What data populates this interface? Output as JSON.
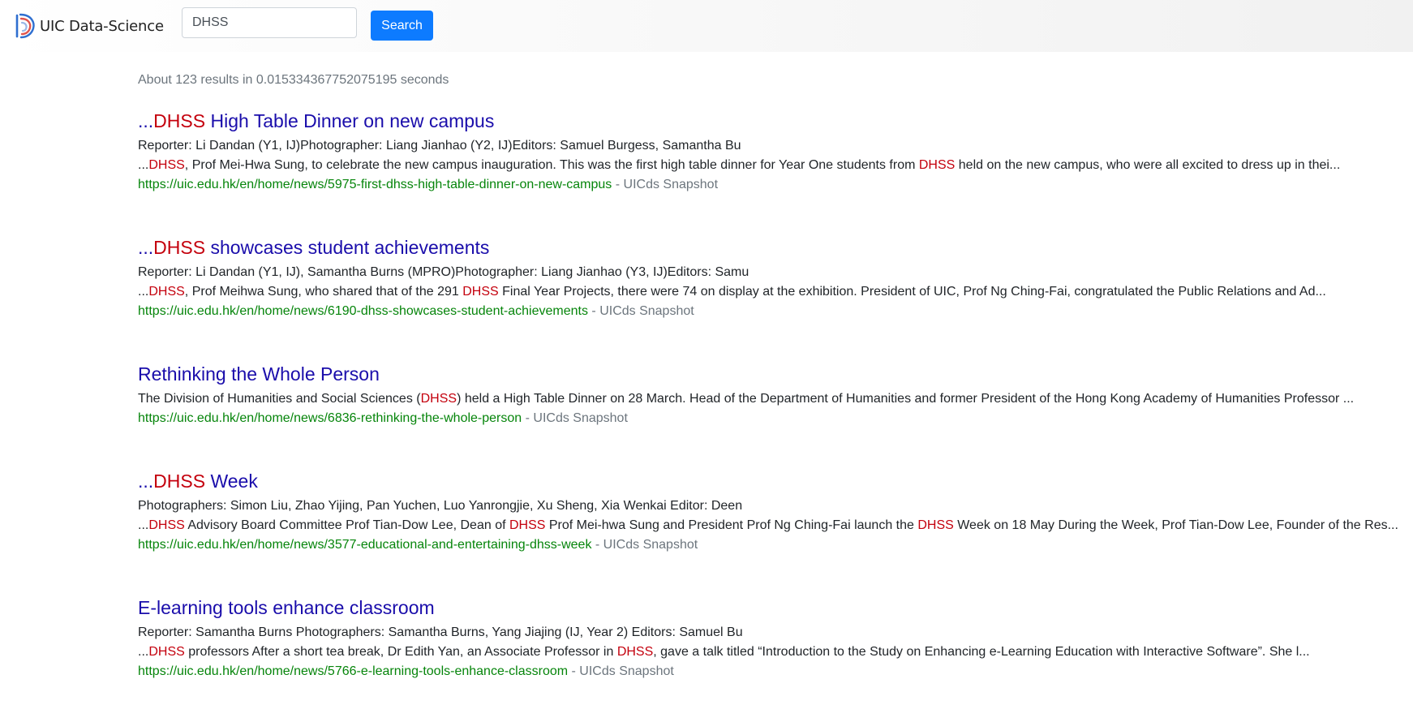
{
  "header": {
    "logo_text": "UIC Data-Science",
    "search_value": "DHSS",
    "search_button_label": "Search"
  },
  "stats_text": "About 123 results in 0.015334367752075195 seconds",
  "separator": " - ",
  "snapshot_label": "UICds Snapshot",
  "colors": {
    "title_link": "#1a0dab",
    "highlight": "#c4000d",
    "url": "#06850b",
    "muted": "#6c757d",
    "search_button": "#0d7bff"
  },
  "results": [
    {
      "title": [
        [
          "...",
          false
        ],
        [
          "DHSS",
          true
        ],
        [
          " High Table Dinner on new campus",
          false
        ]
      ],
      "lines": [
        [
          [
            "Reporter: Li Dandan (Y1, IJ)Photographer: Liang Jianhao (Y2, IJ)Editors: Samuel Burgess, Samantha Bu",
            false
          ]
        ],
        [
          [
            "...",
            false
          ],
          [
            "DHSS",
            true
          ],
          [
            ", Prof Mei-Hwa Sung, to celebrate the new campus inauguration. This was the first high table dinner for Year One students from ",
            false
          ],
          [
            "DHSS",
            true
          ],
          [
            " held on the new campus, who were all excited to dress up in thei...",
            false
          ]
        ]
      ],
      "url": "https://uic.edu.hk/en/home/news/5975-first-dhss-high-table-dinner-on-new-campus"
    },
    {
      "title": [
        [
          "...",
          false
        ],
        [
          "DHSS",
          true
        ],
        [
          " showcases student achievements",
          false
        ]
      ],
      "lines": [
        [
          [
            "Reporter: Li Dandan (Y1, IJ), Samantha Burns (MPRO)Photographer: Liang Jianhao (Y3, IJ)Editors: Samu",
            false
          ]
        ],
        [
          [
            "...",
            false
          ],
          [
            "DHSS",
            true
          ],
          [
            ", Prof Meihwa Sung, who shared that of the 291 ",
            false
          ],
          [
            "DHSS",
            true
          ],
          [
            " Final Year Projects, there were 74 on display at the exhibition. President of UIC, Prof Ng Ching-Fai, congratulated the Public Relations and Ad...",
            false
          ]
        ]
      ],
      "url": "https://uic.edu.hk/en/home/news/6190-dhss-showcases-student-achievements"
    },
    {
      "title": [
        [
          "Rethinking the Whole Person",
          false
        ]
      ],
      "lines": [
        [
          [
            "The Division of Humanities and Social Sciences (",
            false
          ],
          [
            "DHSS",
            true
          ],
          [
            ") held a High Table Dinner on 28 March. Head of the Department of Humanities and former President of the Hong Kong Academy of Humanities Professor ...",
            false
          ]
        ]
      ],
      "url": "https://uic.edu.hk/en/home/news/6836-rethinking-the-whole-person"
    },
    {
      "title": [
        [
          "...",
          false
        ],
        [
          "DHSS",
          true
        ],
        [
          " Week",
          false
        ]
      ],
      "lines": [
        [
          [
            "Photographers: Simon Liu, Zhao Yijing, Pan Yuchen, Luo Yanrongjie, Xu Sheng, Xia Wenkai Editor: Deen",
            false
          ]
        ],
        [
          [
            "...",
            false
          ],
          [
            "DHSS",
            true
          ],
          [
            " Advisory Board Committee Prof Tian-Dow Lee, Dean of ",
            false
          ],
          [
            "DHSS",
            true
          ],
          [
            " Prof Mei-hwa Sung and President Prof Ng Ching-Fai launch the ",
            false
          ],
          [
            "DHSS",
            true
          ],
          [
            " Week on 18 May During the Week, Prof Tian-Dow Lee, Founder of the Res...",
            false
          ]
        ]
      ],
      "url": "https://uic.edu.hk/en/home/news/3577-educational-and-entertaining-dhss-week"
    },
    {
      "title": [
        [
          "E-learning tools enhance classroom",
          false
        ]
      ],
      "lines": [
        [
          [
            "Reporter: Samantha Burns Photographers: Samantha Burns, Yang Jiajing (IJ, Year 2) Editors: Samuel Bu",
            false
          ]
        ],
        [
          [
            "...",
            false
          ],
          [
            "DHSS",
            true
          ],
          [
            " professors After a short tea break, Dr Edith Yan, an Associate Professor in ",
            false
          ],
          [
            "DHSS",
            true
          ],
          [
            ", gave a talk titled “Introduction to the Study on Enhancing e-Learning Education with Interactive Software”. She l...",
            false
          ]
        ]
      ],
      "url": "https://uic.edu.hk/en/home/news/5766-e-learning-tools-enhance-classroom"
    }
  ]
}
